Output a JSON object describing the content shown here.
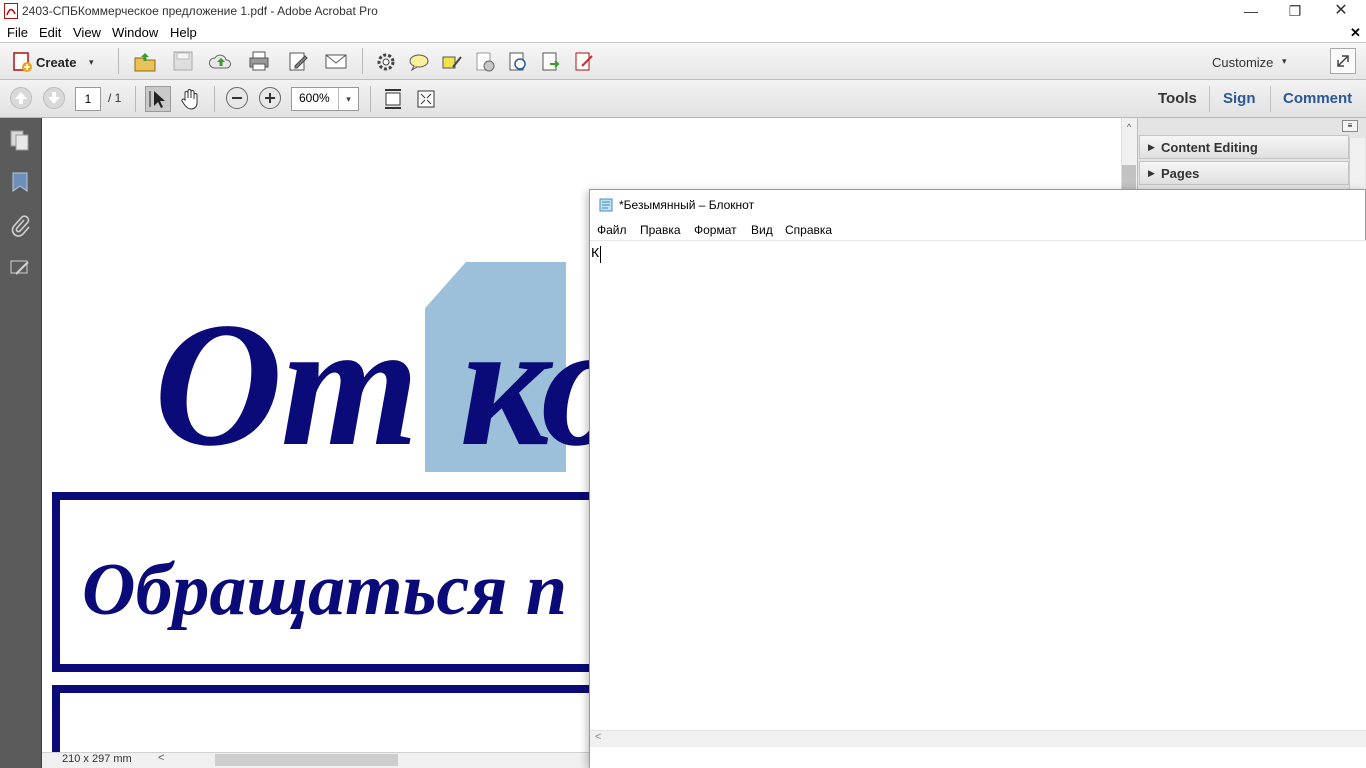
{
  "window": {
    "title": "2403-СПБКоммерческое предложение 1.pdf - Adobe Acrobat Pro",
    "minimize": "—",
    "restore": "❐",
    "close": "✕"
  },
  "menu": {
    "file": "File",
    "edit": "Edit",
    "view": "View",
    "window": "Window",
    "help": "Help",
    "doc_close": "✕"
  },
  "toolbar": {
    "create_label": "Create",
    "create_arrow": "▾",
    "customize_label": "Customize",
    "customize_arrow": "▾",
    "icons": [
      "open-icon",
      "save-icon",
      "upload-icon",
      "print-icon",
      "edit-icon",
      "email-icon",
      "settings-icon",
      "comment-bubble-icon",
      "highlight-icon",
      "stamp-icon",
      "export-icon",
      "send-icon",
      "sign-doc-icon"
    ]
  },
  "navbar": {
    "page_current": "1",
    "page_total": "/ 1",
    "zoom": "600%",
    "zoom_arrow": "▾",
    "tabs": {
      "tools": "Tools",
      "sign": "Sign",
      "comment": "Comment"
    }
  },
  "document": {
    "heading_partial": "От ко",
    "line2_partial": "Обращаться п",
    "page_size": "210 x 297 mm",
    "scroll_left": "<",
    "scroll_up": "^"
  },
  "panel": {
    "options_glyph": "≡",
    "sections": [
      {
        "label": "Content Editing",
        "glyph": "▶"
      },
      {
        "label": "Pages",
        "glyph": "▶"
      }
    ]
  },
  "notepad": {
    "title": "*Безымянный – Блокнот",
    "menu": {
      "file": "Файл",
      "edit": "Правка",
      "format": "Формат",
      "view": "Вид",
      "help": "Справка"
    },
    "content": "К",
    "scroll_left": "<"
  },
  "colors": {
    "doc_text": "#0a0a78",
    "selection": "#9cc0da",
    "tab_link": "#2b5796",
    "left_nav": "#5b5b5b"
  }
}
